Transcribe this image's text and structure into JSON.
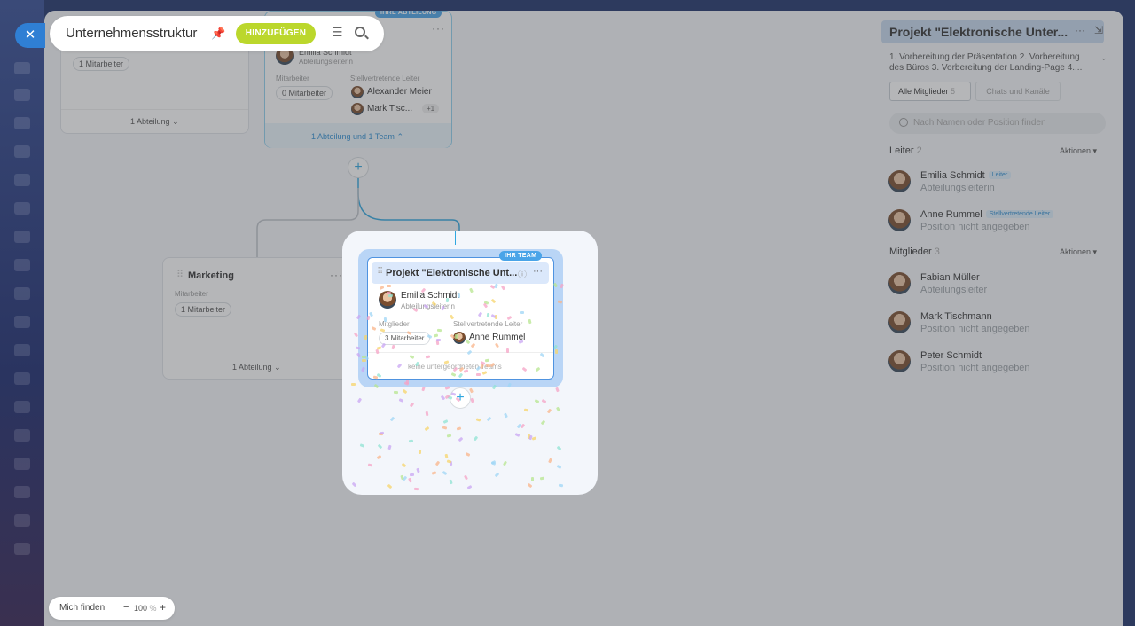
{
  "header": {
    "title": "Unternehmensstruktur",
    "add_button": "HINZUFÜGEN"
  },
  "cards": {
    "top_left": {
      "employees_pill": "1 Mitarbeiter",
      "footer": "1 Abteilung"
    },
    "top_center": {
      "badge": "IHRE ABTEILUNG",
      "head_name": "Emilia Schmidt",
      "head_position": "Abteilungsleiterin",
      "employees_label": "Mitarbeiter",
      "employees_pill": "0 Mitarbeiter",
      "deputies_label": "Stellvertretende Leiter",
      "deputy1": "Alexander Meier",
      "deputy2": "Mark Tisc...",
      "deputy_more": "+1",
      "footer": "1 Abteilung und 1 Team"
    },
    "marketing": {
      "title": "Marketing",
      "employees_label": "Mitarbeiter",
      "employees_pill": "1 Mitarbeiter",
      "footer": "1 Abteilung"
    },
    "project": {
      "badge": "IHR TEAM",
      "title": "Projekt \"Elektronische Unt...",
      "head_name": "Emilia Schmidt",
      "head_position": "Abteilungsleiterin",
      "members_label": "Mitglieder",
      "members_pill": "3 Mitarbeiter",
      "deputies_label": "Stellvertretende Leiter",
      "deputy1": "Anne Rummel",
      "footer": "keine untergeordneten Teams"
    }
  },
  "bottom": {
    "find_me": "Mich finden",
    "zoom_minus": "−",
    "zoom_value": "100",
    "zoom_unit": "%",
    "zoom_plus": "+"
  },
  "panel": {
    "title": "Projekt \"Elektronische Unter...",
    "description": "1. Vorbereitung der Präsentation 2. Vorbereitung des Büros 3. Vorbereitung der Landing-Page 4....",
    "tab_all": "Alle Mitglieder",
    "tab_all_count": "5",
    "tab_chats": "Chats und Kanäle",
    "search_placeholder": "Nach Namen oder Position finden",
    "leaders_label": "Leiter",
    "leaders_count": "2",
    "members_label": "Mitglieder",
    "members_count": "3",
    "actions": "Aktionen",
    "leaders": [
      {
        "name": "Emilia Schmidt",
        "tag": "Leiter",
        "position": "Abteilungsleiterin"
      },
      {
        "name": "Anne Rummel",
        "tag": "Stellvertretende Leiter",
        "position": "Position nicht angegeben"
      }
    ],
    "members": [
      {
        "name": "Fabian Müller",
        "position": "Abteilungsleiter"
      },
      {
        "name": "Mark Tischmann",
        "position": "Position nicht angegeben"
      },
      {
        "name": "Peter Schmidt",
        "position": "Position nicht angegeben"
      }
    ]
  },
  "icons": {
    "close": "close-icon",
    "pin": "pin-icon",
    "menu": "menu-icon",
    "search": "search-icon",
    "more": "more-icon",
    "collapse": "collapse-panel-icon",
    "info": "info-icon",
    "drag": "drag-handle-icon",
    "chevron": "chevron-icon"
  },
  "colors": {
    "accent": "#2fa7e0",
    "add_button": "#bbd72c",
    "badge": "#4aa4e8"
  }
}
